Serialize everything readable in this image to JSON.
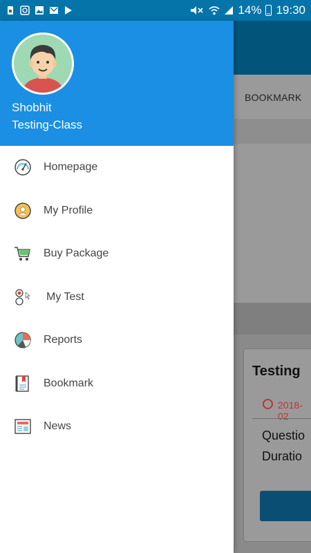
{
  "status_bar": {
    "battery": "14%",
    "time": "19:30",
    "left_icons": [
      "sim-icon",
      "sync-icon",
      "image-icon",
      "gmail-icon",
      "play-store-icon"
    ],
    "right_icons": [
      "mute-icon",
      "wifi-icon",
      "signal-icon",
      "battery-icon"
    ]
  },
  "drawer": {
    "user": {
      "name": "Shobhit",
      "class": "Testing-Class"
    },
    "items": [
      {
        "label": "Homepage",
        "icon": "speedometer-icon"
      },
      {
        "label": "My Profile",
        "icon": "profile-icon"
      },
      {
        "label": "Buy Package",
        "icon": "cart-icon"
      },
      {
        "label": "My Test",
        "icon": "radio-test-icon"
      },
      {
        "label": "Reports",
        "icon": "pie-chart-icon"
      },
      {
        "label": "Bookmark",
        "icon": "bookmark-icon"
      },
      {
        "label": "News",
        "icon": "newspaper-icon"
      }
    ]
  },
  "background_app": {
    "tab_label": "BOOKMARK",
    "card_title": "Testing",
    "card_date": "2018-02",
    "card_questions": "Questio",
    "card_duration": "Duratio"
  },
  "colors": {
    "status_bar": "#0574a8",
    "drawer_header": "#1a8fe3",
    "menu_text": "#444444"
  }
}
